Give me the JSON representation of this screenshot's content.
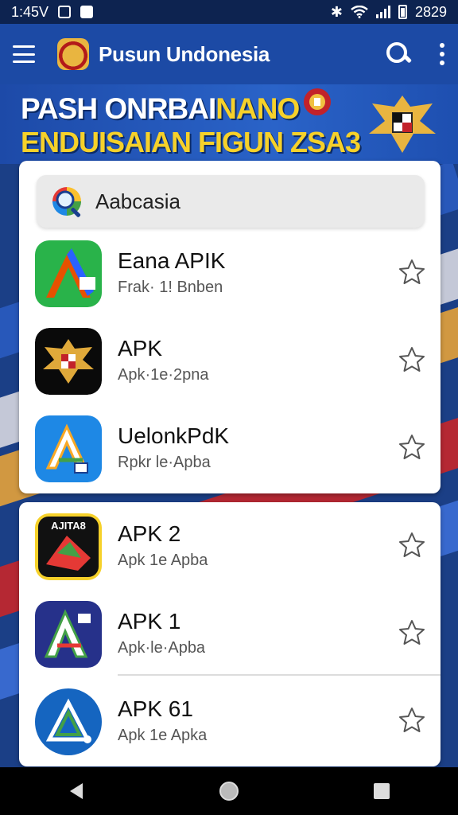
{
  "status_bar": {
    "time_left": "1:45V",
    "time_right": "2829"
  },
  "app_bar": {
    "title": "Pusun Undonesia"
  },
  "banner": {
    "line1_white": "PASH ONRBAI",
    "line1_yellow": "NANO",
    "line2": "ENDUISAIAN FIGUN ZSA3"
  },
  "search": {
    "value": "Aabcasia"
  },
  "apps": [
    {
      "title": "Eana APIK",
      "subtitle": "Frak· 1! Bnben",
      "icon": "green-a-icon"
    },
    {
      "title": "APK",
      "subtitle": "Apk·1e·2pna",
      "icon": "garuda-icon"
    },
    {
      "title": "UelonkPdK",
      "subtitle": "Rpkr le·Apba",
      "icon": "blue-a-icon"
    },
    {
      "title": "APK  2",
      "subtitle": "Apk 1e Apba",
      "icon": "red-yellow-a-icon",
      "badge": "AJITA8"
    },
    {
      "title": "APK  1",
      "subtitle": "Apk·le·Apba",
      "icon": "navy-a-icon"
    },
    {
      "title": "APK  61",
      "subtitle": "Apk 1e Apka",
      "icon": "blue-delta-icon"
    }
  ],
  "colors": {
    "status_bar": "#0d2350",
    "app_bar": "#1c4aa5",
    "banner_yellow": "#f6d12a",
    "card": "#ffffff",
    "nav_bar": "#000000"
  }
}
